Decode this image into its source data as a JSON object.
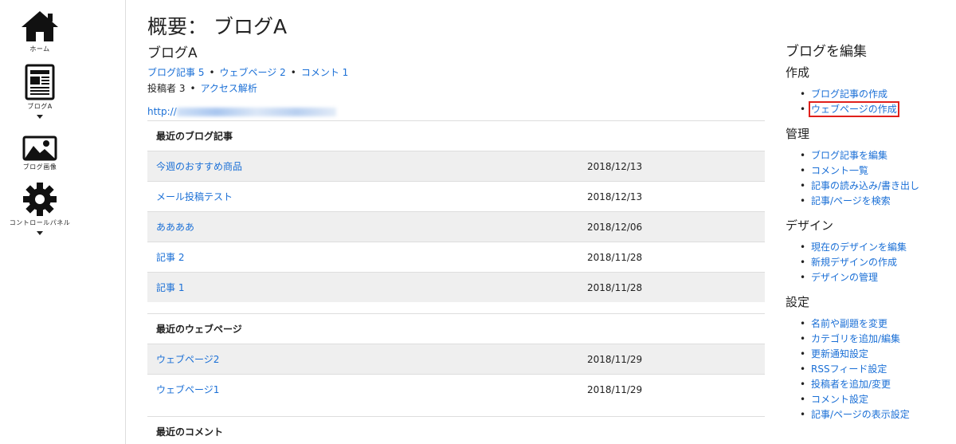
{
  "sidebar": {
    "items": [
      {
        "label": "ホーム",
        "icon": "home-icon"
      },
      {
        "label": "ブログA",
        "icon": "blog-icon"
      },
      {
        "label": "ブログ画像",
        "icon": "image-icon"
      },
      {
        "label": "コントロールパネル",
        "icon": "gear-icon"
      }
    ]
  },
  "main": {
    "page_title": "概要： ブログA",
    "blog_name": "ブログA",
    "stats": {
      "articles": "ブログ記事 5",
      "webpages": "ウェブページ 2",
      "comments": "コメント 1",
      "posters": "投稿者 3",
      "analytics": "アクセス解析"
    },
    "blog_url_prefix": "http://",
    "sections": {
      "recent_articles": {
        "header": "最近のブログ記事",
        "rows": [
          {
            "title": "今週のおすすめ商品",
            "date": "2018/12/13"
          },
          {
            "title": "メール投稿テスト",
            "date": "2018/12/13"
          },
          {
            "title": "ああああ",
            "date": "2018/12/06"
          },
          {
            "title": "記事 2",
            "date": "2018/11/28"
          },
          {
            "title": "記事 1",
            "date": "2018/11/28"
          }
        ]
      },
      "recent_webpages": {
        "header": "最近のウェブページ",
        "rows": [
          {
            "title": "ウェブページ2",
            "date": "2018/11/29"
          },
          {
            "title": "ウェブページ1",
            "date": "2018/11/29"
          }
        ]
      },
      "recent_comments": {
        "header": "最近のコメント"
      }
    }
  },
  "right": {
    "title": "ブログを編集",
    "groups": [
      {
        "heading": "作成",
        "items": [
          "ブログ記事の作成",
          "ウェブページの作成"
        ]
      },
      {
        "heading": "管理",
        "items": [
          "ブログ記事を編集",
          "コメント一覧",
          "記事の読み込み/書き出し",
          "記事/ページを検索"
        ]
      },
      {
        "heading": "デザイン",
        "items": [
          "現在のデザインを編集",
          "新規デザインの作成",
          "デザインの管理"
        ]
      },
      {
        "heading": "設定",
        "items": [
          "名前や副題を変更",
          "カテゴリを追加/編集",
          "更新通知設定",
          "RSSフィード設定",
          "投稿者を追加/変更",
          "コメント設定",
          "記事/ページの表示設定"
        ]
      }
    ]
  },
  "colors": {
    "link": "#1a6fd6",
    "row_alt": "#efefef",
    "highlight": "#e0201b"
  }
}
